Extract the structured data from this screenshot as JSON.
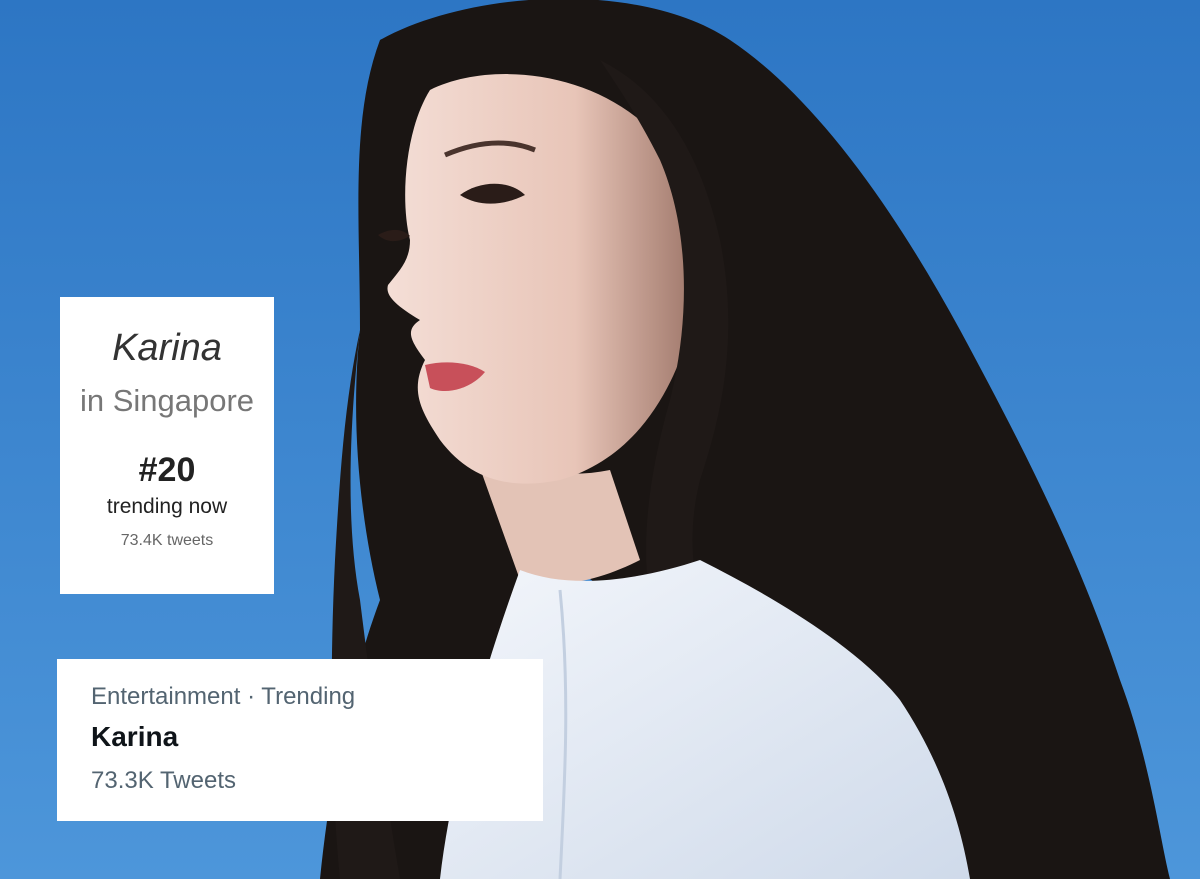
{
  "colors": {
    "sky": "#3b87d2",
    "hair": "#1a1513",
    "shirt": "#e9eef6",
    "card_bg": "#ffffff",
    "muted_text": "#536471"
  },
  "trend_card": {
    "topic": "Karina",
    "location": "in Singapore",
    "rank": "#20",
    "status": "trending now",
    "count": "73.4K tweets"
  },
  "twitter_trend": {
    "context": "Entertainment · Trending",
    "name": "Karina",
    "tweets": "73.3K Tweets"
  }
}
